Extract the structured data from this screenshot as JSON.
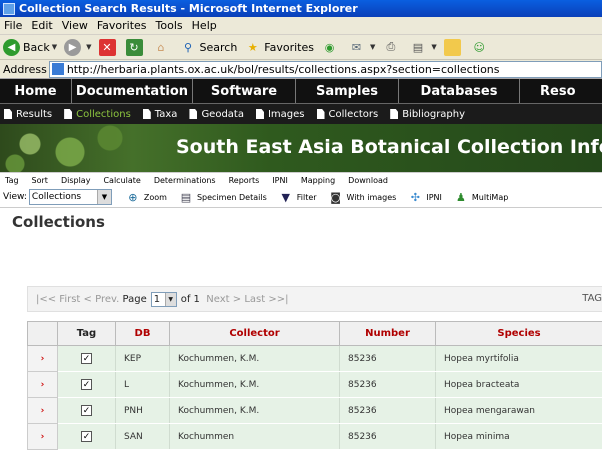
{
  "window": {
    "title": "Collection Search Results - Microsoft Internet Explorer"
  },
  "menu": [
    "File",
    "Edit",
    "View",
    "Favorites",
    "Tools",
    "Help"
  ],
  "toolbar": {
    "back": "Back",
    "search": "Search",
    "favorites": "Favorites"
  },
  "address": {
    "label": "Address",
    "url": "http://herbaria.plants.ox.ac.uk/bol/results/collections.aspx?section=collections"
  },
  "main_nav": [
    "Home",
    "Documentation",
    "Software",
    "Samples",
    "Databases",
    "Reso"
  ],
  "sub_nav": [
    {
      "label": "Results",
      "active": false
    },
    {
      "label": "Collections",
      "active": true
    },
    {
      "label": "Taxa",
      "active": false
    },
    {
      "label": "Geodata",
      "active": false
    },
    {
      "label": "Images",
      "active": false
    },
    {
      "label": "Collectors",
      "active": false
    },
    {
      "label": "Bibliography",
      "active": false
    }
  ],
  "banner": {
    "title": "South East Asia Botanical Collection Info"
  },
  "app_menu": [
    "Tag",
    "Sort",
    "Display",
    "Calculate",
    "Determinations",
    "Reports",
    "IPNI",
    "Mapping",
    "Download"
  ],
  "app_tools": {
    "view_label": "View:",
    "view_value": "Collections",
    "items": [
      {
        "label": "Zoom",
        "icon": "zoom-icon"
      },
      {
        "label": "Specimen Details",
        "icon": "specimen-details-icon"
      },
      {
        "label": "Filter",
        "icon": "filter-icon"
      },
      {
        "label": "With images",
        "icon": "camera-icon"
      },
      {
        "label": "IPNI",
        "icon": "ipni-icon"
      },
      {
        "label": "MultiMap",
        "icon": "multimap-icon"
      }
    ]
  },
  "heading": "Collections",
  "pager": {
    "first": "|<< First",
    "prev": "< Prev.",
    "page_label": "Page",
    "page_value": "1",
    "of_label": "of 1",
    "next": "Next >",
    "last": "Last >>|",
    "tag_label": "TAG"
  },
  "table": {
    "columns": [
      "",
      "Tag",
      "DB",
      "Collector",
      "Number",
      "Species"
    ],
    "rows": [
      {
        "db": "KEP",
        "collector": "Kochummen, K.M.",
        "number": "85236",
        "species": "Hopea myrtifolia",
        "tagged": true
      },
      {
        "db": "L",
        "collector": "Kochummen, K.M.",
        "number": "85236",
        "species": "Hopea bracteata",
        "tagged": true
      },
      {
        "db": "PNH",
        "collector": "Kochummen, K.M.",
        "number": "85236",
        "species": "Hopea mengarawan",
        "tagged": true
      },
      {
        "db": "SAN",
        "collector": "Kochummen",
        "number": "85236",
        "species": "Hopea minima",
        "tagged": true
      }
    ]
  },
  "colors": {
    "title_bar": "#0a4fd0",
    "nav_bg": "#111111",
    "active_subnav": "#8dc63f",
    "header_text": "#b00000",
    "row_bg": "#e6f2e6"
  }
}
